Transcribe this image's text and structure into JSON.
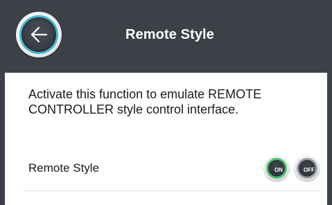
{
  "header": {
    "title": "Remote Style",
    "back_icon": "back-arrow-icon",
    "accent_color": "#3fb8d6",
    "background_color": "#3c4047"
  },
  "content": {
    "description": "Activate this function to emulate REMOTE CONTROLLER style control interface.",
    "setting": {
      "label": "Remote Style",
      "on_label": "ON",
      "off_label": "OFF",
      "selected": "ON",
      "on_color": "#4cc36a",
      "off_color": "#9aa0a6"
    }
  }
}
